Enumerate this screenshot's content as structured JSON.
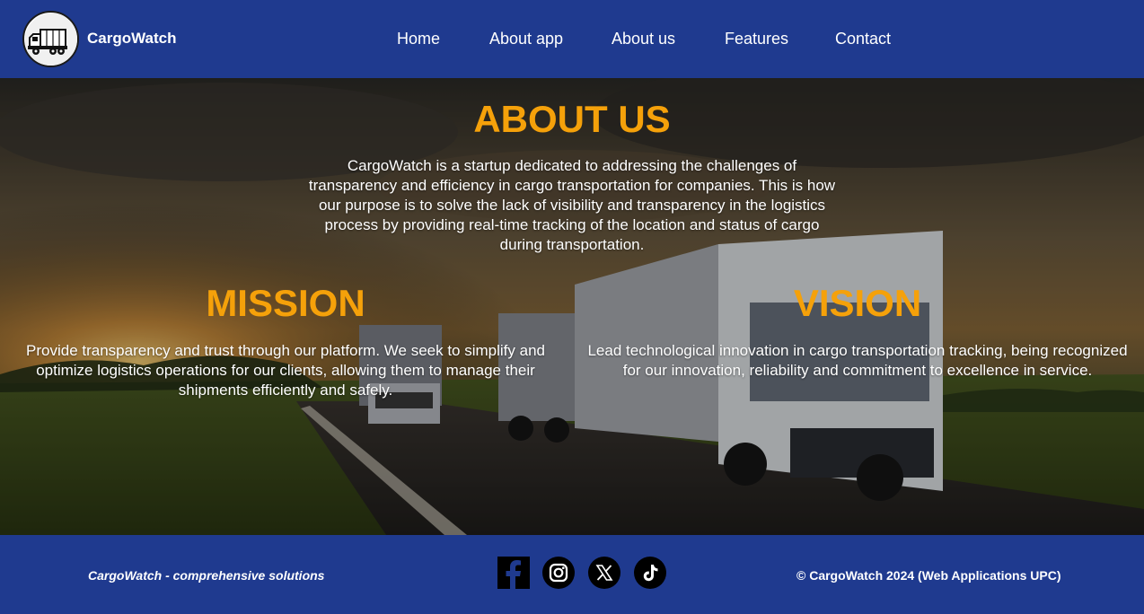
{
  "brand": {
    "name": "CargoWatch",
    "logo_icon": "truck-logo-icon"
  },
  "nav": {
    "items": [
      {
        "label": "Home"
      },
      {
        "label": "About app"
      },
      {
        "label": "About us"
      },
      {
        "label": "Features"
      },
      {
        "label": "Contact"
      }
    ]
  },
  "about": {
    "title": "ABOUT US",
    "text": "CargoWatch is a startup dedicated to addressing the challenges of transparency and efficiency in cargo transportation for companies. This is how our purpose is to solve the lack of visibility and transparency in the logistics process by providing real-time tracking of the location and status of cargo during transportation."
  },
  "mission": {
    "title": "MISSION",
    "text": "Provide transparency and trust through our platform. We seek to simplify and optimize logistics operations for our clients, allowing them to manage their shipments efficiently and safely."
  },
  "vision": {
    "title": "VISION",
    "text": "Lead technological innovation in cargo transportation tracking, being recognized for our innovation, reliability and commitment to excellence in service."
  },
  "footer": {
    "tagline": "CargoWatch - comprehensive solutions",
    "copyright": "© CargoWatch 2024 (Web Applications UPC)",
    "social_icons": [
      "facebook-icon",
      "instagram-icon",
      "x-icon",
      "tiktok-icon"
    ]
  },
  "colors": {
    "nav_background": "#1f3a8f",
    "heading_accent": "#f5a10a",
    "text": "#ffffff"
  }
}
